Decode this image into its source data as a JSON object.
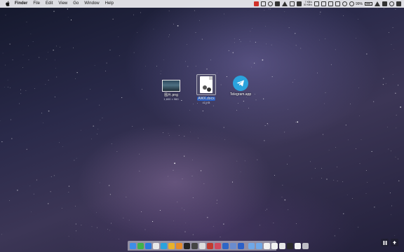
{
  "menubar": {
    "app_name": "Finder",
    "menus": [
      "File",
      "Edit",
      "View",
      "Go",
      "Window",
      "Help"
    ],
    "network_speed": [
      "7 KB/s",
      "30 KB/s"
    ],
    "battery": "99%"
  },
  "desktop": {
    "items": [
      {
        "name": "图片.png",
        "detail": "1,600 × 960",
        "icon": "image-thumbnail-icon",
        "selected": false
      },
      {
        "name": "AWX.docs",
        "detail": "42 KB",
        "icon": "document-icon",
        "selected": true
      },
      {
        "name": "Telegram.app",
        "detail": "",
        "icon": "telegram-app-icon",
        "selected": false
      }
    ]
  },
  "dock": {
    "apps": [
      {
        "icon": "finder-icon",
        "color": "#3d8ee8"
      },
      {
        "icon": "wechat-icon",
        "color": "#3fb34a"
      },
      {
        "icon": "safari-icon",
        "color": "#2a7be0"
      },
      {
        "icon": "clock-icon",
        "color": "#e9e9e9"
      },
      {
        "icon": "telegram-icon",
        "color": "#2ba3dd"
      },
      {
        "icon": "chrome-icon",
        "color": "#e9b22a"
      },
      {
        "icon": "sublime-icon",
        "color": "#e58a2a"
      },
      {
        "icon": "terminal-icon",
        "color": "#222222"
      },
      {
        "icon": "app-icon",
        "color": "#444444"
      },
      {
        "icon": "app-icon",
        "color": "#dddddd"
      },
      {
        "icon": "app-icon",
        "color": "#c23a2f"
      },
      {
        "icon": "app-icon",
        "color": "#d04a5f"
      },
      {
        "icon": "1password-icon",
        "color": "#2e66c6"
      },
      {
        "icon": "app-icon",
        "color": "#6a8ccf"
      },
      {
        "icon": "app-icon",
        "color": "#2a5fc8"
      }
    ],
    "docs": [
      {
        "icon": "folder-icon",
        "color": "#6fa8e8"
      },
      {
        "icon": "folder-icon",
        "color": "#6fa8e8"
      },
      {
        "icon": "window-icon",
        "color": "#f2f2f2"
      },
      {
        "icon": "window-icon",
        "color": "#f2f2f2"
      },
      {
        "icon": "window-icon",
        "color": "#e6e6e6"
      },
      {
        "icon": "window-icon",
        "color": "#2b2b2b"
      },
      {
        "icon": "window-icon",
        "color": "#f2f2f2"
      },
      {
        "icon": "trash-icon",
        "color": "#bdbdc4"
      }
    ]
  },
  "colors": {
    "selection": "#2f66d0",
    "menubar": "#ececf0",
    "accent_red": "#d0302a"
  }
}
